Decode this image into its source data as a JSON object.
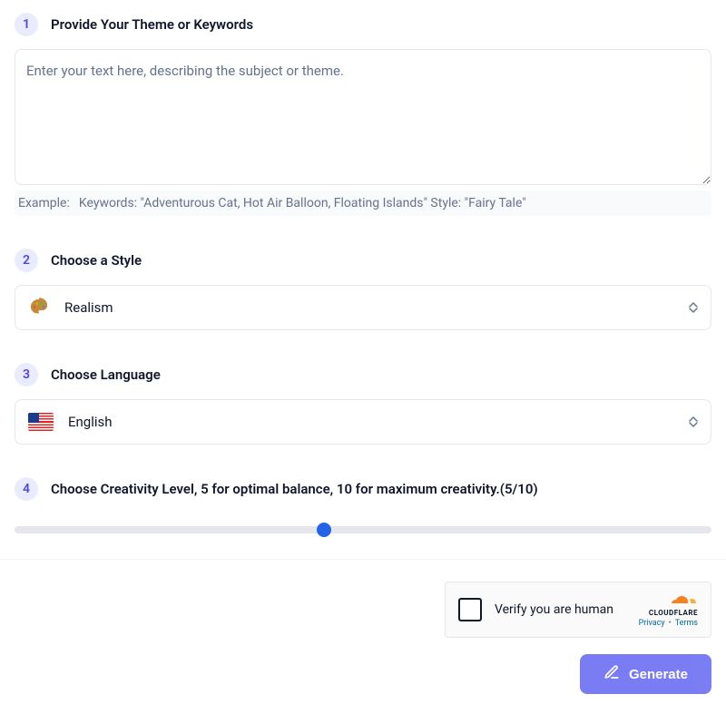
{
  "steps": {
    "theme": {
      "number": "1",
      "title": "Provide Your Theme or Keywords",
      "placeholder": "Enter your text here, describing the subject or theme.",
      "value": "",
      "example_label": "Example:",
      "example_text": "Keywords: \"Adventurous Cat, Hot Air Balloon, Floating Islands\" Style: \"Fairy Tale\""
    },
    "style": {
      "number": "2",
      "title": "Choose a Style",
      "selected": "Realism",
      "icon": "palette-icon"
    },
    "language": {
      "number": "3",
      "title": "Choose Language",
      "selected": "English",
      "icon": "flag-us"
    },
    "creativity": {
      "number": "4",
      "title": "Choose Creativity Level, 5 for optimal balance, 10 for maximum creativity.(5/10)",
      "value": 5,
      "min": 1,
      "max": 10
    }
  },
  "captcha": {
    "label": "Verify you are human",
    "brand": "CLOUDFLARE",
    "privacy": "Privacy",
    "terms": "Terms"
  },
  "actions": {
    "generate": "Generate"
  },
  "colors": {
    "accent": "#6366f1",
    "slider_thumb": "#2563eb"
  }
}
